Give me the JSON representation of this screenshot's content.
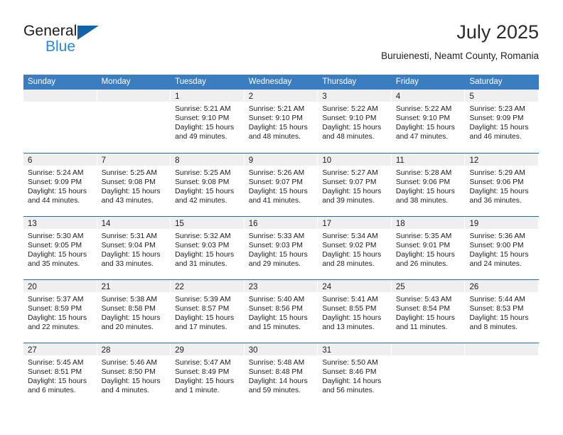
{
  "brand": {
    "name_part1": "General",
    "name_part2": "Blue",
    "accent_color": "#2a87d8",
    "triangle_color": "#1264a8"
  },
  "header": {
    "title": "July 2025",
    "subtitle": "Buruienesti, Neamt County, Romania"
  },
  "calendar": {
    "header_bg": "#3a7dc0",
    "row_rule_color": "#1f6cb0",
    "day_band_bg": "#efefef",
    "weekdays": [
      "Sunday",
      "Monday",
      "Tuesday",
      "Wednesday",
      "Thursday",
      "Friday",
      "Saturday"
    ],
    "weeks": [
      [
        {
          "day": "",
          "sunrise": "",
          "sunset": "",
          "daylight": "",
          "empty": true
        },
        {
          "day": "",
          "sunrise": "",
          "sunset": "",
          "daylight": "",
          "empty": true
        },
        {
          "day": "1",
          "sunrise": "Sunrise: 5:21 AM",
          "sunset": "Sunset: 9:10 PM",
          "daylight": "Daylight: 15 hours and 49 minutes."
        },
        {
          "day": "2",
          "sunrise": "Sunrise: 5:21 AM",
          "sunset": "Sunset: 9:10 PM",
          "daylight": "Daylight: 15 hours and 48 minutes."
        },
        {
          "day": "3",
          "sunrise": "Sunrise: 5:22 AM",
          "sunset": "Sunset: 9:10 PM",
          "daylight": "Daylight: 15 hours and 48 minutes."
        },
        {
          "day": "4",
          "sunrise": "Sunrise: 5:22 AM",
          "sunset": "Sunset: 9:10 PM",
          "daylight": "Daylight: 15 hours and 47 minutes."
        },
        {
          "day": "5",
          "sunrise": "Sunrise: 5:23 AM",
          "sunset": "Sunset: 9:09 PM",
          "daylight": "Daylight: 15 hours and 46 minutes."
        }
      ],
      [
        {
          "day": "6",
          "sunrise": "Sunrise: 5:24 AM",
          "sunset": "Sunset: 9:09 PM",
          "daylight": "Daylight: 15 hours and 44 minutes."
        },
        {
          "day": "7",
          "sunrise": "Sunrise: 5:25 AM",
          "sunset": "Sunset: 9:08 PM",
          "daylight": "Daylight: 15 hours and 43 minutes."
        },
        {
          "day": "8",
          "sunrise": "Sunrise: 5:25 AM",
          "sunset": "Sunset: 9:08 PM",
          "daylight": "Daylight: 15 hours and 42 minutes."
        },
        {
          "day": "9",
          "sunrise": "Sunrise: 5:26 AM",
          "sunset": "Sunset: 9:07 PM",
          "daylight": "Daylight: 15 hours and 41 minutes."
        },
        {
          "day": "10",
          "sunrise": "Sunrise: 5:27 AM",
          "sunset": "Sunset: 9:07 PM",
          "daylight": "Daylight: 15 hours and 39 minutes."
        },
        {
          "day": "11",
          "sunrise": "Sunrise: 5:28 AM",
          "sunset": "Sunset: 9:06 PM",
          "daylight": "Daylight: 15 hours and 38 minutes."
        },
        {
          "day": "12",
          "sunrise": "Sunrise: 5:29 AM",
          "sunset": "Sunset: 9:06 PM",
          "daylight": "Daylight: 15 hours and 36 minutes."
        }
      ],
      [
        {
          "day": "13",
          "sunrise": "Sunrise: 5:30 AM",
          "sunset": "Sunset: 9:05 PM",
          "daylight": "Daylight: 15 hours and 35 minutes."
        },
        {
          "day": "14",
          "sunrise": "Sunrise: 5:31 AM",
          "sunset": "Sunset: 9:04 PM",
          "daylight": "Daylight: 15 hours and 33 minutes."
        },
        {
          "day": "15",
          "sunrise": "Sunrise: 5:32 AM",
          "sunset": "Sunset: 9:03 PM",
          "daylight": "Daylight: 15 hours and 31 minutes."
        },
        {
          "day": "16",
          "sunrise": "Sunrise: 5:33 AM",
          "sunset": "Sunset: 9:03 PM",
          "daylight": "Daylight: 15 hours and 29 minutes."
        },
        {
          "day": "17",
          "sunrise": "Sunrise: 5:34 AM",
          "sunset": "Sunset: 9:02 PM",
          "daylight": "Daylight: 15 hours and 28 minutes."
        },
        {
          "day": "18",
          "sunrise": "Sunrise: 5:35 AM",
          "sunset": "Sunset: 9:01 PM",
          "daylight": "Daylight: 15 hours and 26 minutes."
        },
        {
          "day": "19",
          "sunrise": "Sunrise: 5:36 AM",
          "sunset": "Sunset: 9:00 PM",
          "daylight": "Daylight: 15 hours and 24 minutes."
        }
      ],
      [
        {
          "day": "20",
          "sunrise": "Sunrise: 5:37 AM",
          "sunset": "Sunset: 8:59 PM",
          "daylight": "Daylight: 15 hours and 22 minutes."
        },
        {
          "day": "21",
          "sunrise": "Sunrise: 5:38 AM",
          "sunset": "Sunset: 8:58 PM",
          "daylight": "Daylight: 15 hours and 20 minutes."
        },
        {
          "day": "22",
          "sunrise": "Sunrise: 5:39 AM",
          "sunset": "Sunset: 8:57 PM",
          "daylight": "Daylight: 15 hours and 17 minutes."
        },
        {
          "day": "23",
          "sunrise": "Sunrise: 5:40 AM",
          "sunset": "Sunset: 8:56 PM",
          "daylight": "Daylight: 15 hours and 15 minutes."
        },
        {
          "day": "24",
          "sunrise": "Sunrise: 5:41 AM",
          "sunset": "Sunset: 8:55 PM",
          "daylight": "Daylight: 15 hours and 13 minutes."
        },
        {
          "day": "25",
          "sunrise": "Sunrise: 5:43 AM",
          "sunset": "Sunset: 8:54 PM",
          "daylight": "Daylight: 15 hours and 11 minutes."
        },
        {
          "day": "26",
          "sunrise": "Sunrise: 5:44 AM",
          "sunset": "Sunset: 8:53 PM",
          "daylight": "Daylight: 15 hours and 8 minutes."
        }
      ],
      [
        {
          "day": "27",
          "sunrise": "Sunrise: 5:45 AM",
          "sunset": "Sunset: 8:51 PM",
          "daylight": "Daylight: 15 hours and 6 minutes."
        },
        {
          "day": "28",
          "sunrise": "Sunrise: 5:46 AM",
          "sunset": "Sunset: 8:50 PM",
          "daylight": "Daylight: 15 hours and 4 minutes."
        },
        {
          "day": "29",
          "sunrise": "Sunrise: 5:47 AM",
          "sunset": "Sunset: 8:49 PM",
          "daylight": "Daylight: 15 hours and 1 minute."
        },
        {
          "day": "30",
          "sunrise": "Sunrise: 5:48 AM",
          "sunset": "Sunset: 8:48 PM",
          "daylight": "Daylight: 14 hours and 59 minutes."
        },
        {
          "day": "31",
          "sunrise": "Sunrise: 5:50 AM",
          "sunset": "Sunset: 8:46 PM",
          "daylight": "Daylight: 14 hours and 56 minutes."
        },
        {
          "day": "",
          "sunrise": "",
          "sunset": "",
          "daylight": "",
          "empty": true
        },
        {
          "day": "",
          "sunrise": "",
          "sunset": "",
          "daylight": "",
          "empty": true
        }
      ]
    ]
  }
}
